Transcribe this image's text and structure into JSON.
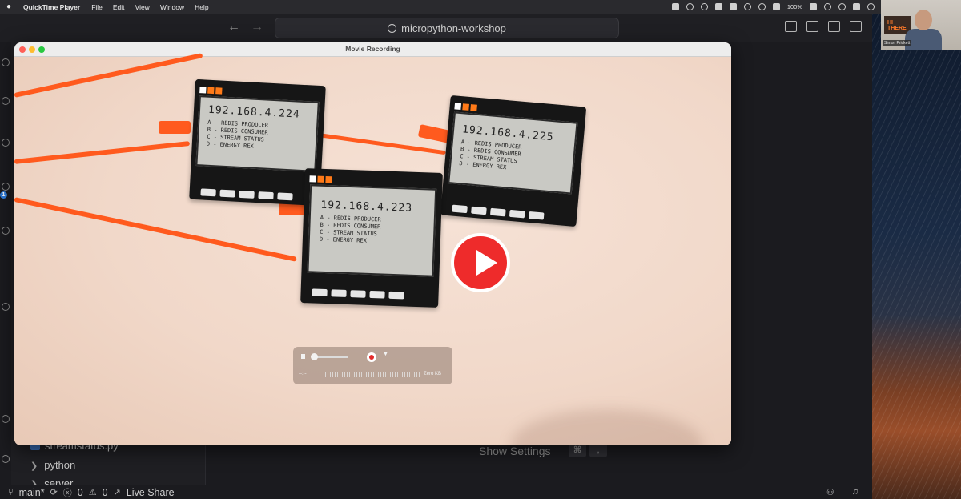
{
  "menubar": {
    "app_name": "QuickTime Player",
    "menus": [
      "File",
      "Edit",
      "View",
      "Window",
      "Help"
    ],
    "battery": "100%",
    "status_icons": [
      "screen-icon",
      "weather-icon",
      "cloud-icon",
      "globe-icon",
      "dropbox-icon",
      "bluetooth-icon",
      "wifi-icon",
      "volume-icon",
      "moon-icon"
    ]
  },
  "vscode": {
    "command_center": "micropython-workshop",
    "badge_count": "1",
    "tree": {
      "file": "streamstatus.py",
      "folder1": "python",
      "folder2": "server"
    },
    "show_settings": "Show Settings",
    "shortcut": [
      "⌘",
      ","
    ]
  },
  "statusbar": {
    "branch": "main*",
    "errors": "0",
    "warnings": "0",
    "live_share": "Live Share"
  },
  "quicktime": {
    "title": "Movie Recording",
    "traffic_lights": [
      "#ff5f57",
      "#febc2e",
      "#28c840"
    ],
    "hud": {
      "time": "--:--",
      "size": "Zero KB"
    }
  },
  "video": {
    "boards": [
      {
        "ip": "192.168.4.224",
        "options": [
          "A - REDIS PRODUCER",
          "B - REDIS CONSUMER",
          "C - STREAM STATUS",
          "D - ENERGY REX"
        ]
      },
      {
        "ip": "192.168.4.225",
        "options": [
          "A - REDIS PRODUCER",
          "B - REDIS CONSUMER",
          "C - STREAM STATUS",
          "D - ENERGY REX"
        ]
      },
      {
        "ip": "192.168.4.223",
        "options": [
          "A - REDIS PRODUCER",
          "B - REDIS CONSUMER",
          "C - STREAM STATUS",
          "D - ENERGY REX"
        ]
      }
    ],
    "play_color": "#ee2b2b"
  },
  "webcam": {
    "sign_text": "HI THERE",
    "name_label": "Simon Prickett"
  }
}
